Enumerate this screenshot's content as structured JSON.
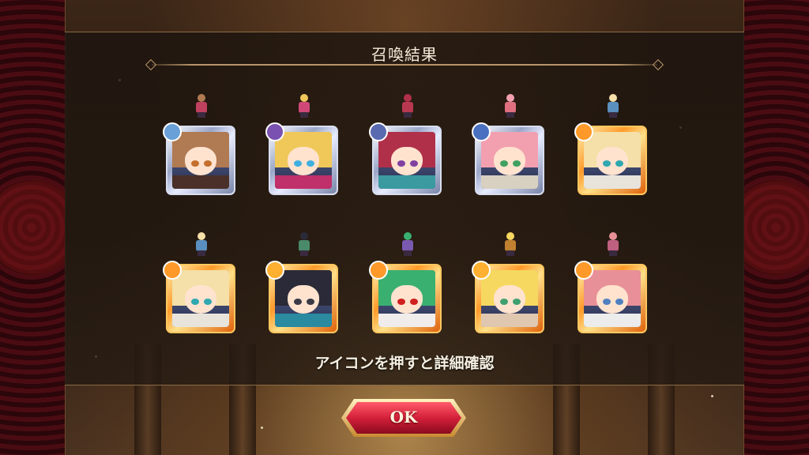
{
  "screen": {
    "title": "召喚結果",
    "hint": "アイコンを押すと詳細確認",
    "ok_label": "OK"
  },
  "colors": {
    "panel_border": "#8a6a45",
    "silver_frame": "#d9def0",
    "gold_frame": "#ffc760",
    "button_red": "#d4203a"
  },
  "results": [
    {
      "rarity": "silver",
      "hair": "#b07a52",
      "eyes": "#c4702c",
      "outfit": "#4a3028",
      "emblem": "#6aa0d8",
      "sprite": "#c04060"
    },
    {
      "rarity": "silver",
      "hair": "#f0c85a",
      "eyes": "#40b0e0",
      "outfit": "#c0306a",
      "emblem": "#7a50b0",
      "sprite": "#d04878"
    },
    {
      "rarity": "silver",
      "hair": "#b0304a",
      "eyes": "#8040a0",
      "outfit": "#3a9aa0",
      "emblem": "#5a6ab0",
      "sprite": "#b83850"
    },
    {
      "rarity": "silver",
      "hair": "#f2a0b0",
      "eyes": "#40a060",
      "outfit": "#d8d0c0",
      "emblem": "#4a70c0",
      "sprite": "#e07080"
    },
    {
      "rarity": "gold",
      "hair": "#f4e0a8",
      "eyes": "#30a8b0",
      "outfit": "#e8e4dc",
      "emblem": "#ff9a2a",
      "sprite": "#5a90c0"
    },
    {
      "rarity": "gold",
      "hair": "#f4e0a8",
      "eyes": "#30a8b0",
      "outfit": "#e8e4dc",
      "emblem": "#ff9a2a",
      "sprite": "#5a90c0"
    },
    {
      "rarity": "gold",
      "hair": "#2a2a38",
      "eyes": "#3a3a48",
      "outfit": "#2a8aa0",
      "emblem": "#ffb030",
      "sprite": "#4a8a6a"
    },
    {
      "rarity": "gold",
      "hair": "#3ab070",
      "eyes": "#d02020",
      "outfit": "#f0ecec",
      "emblem": "#ff9a2a",
      "sprite": "#7a5ab0"
    },
    {
      "rarity": "gold",
      "hair": "#f6d860",
      "eyes": "#40a070",
      "outfit": "#e0c8b0",
      "emblem": "#ffb030",
      "sprite": "#c08030"
    },
    {
      "rarity": "gold",
      "hair": "#e89098",
      "eyes": "#5080c0",
      "outfit": "#ececec",
      "emblem": "#ff9a2a",
      "sprite": "#c06080"
    }
  ]
}
